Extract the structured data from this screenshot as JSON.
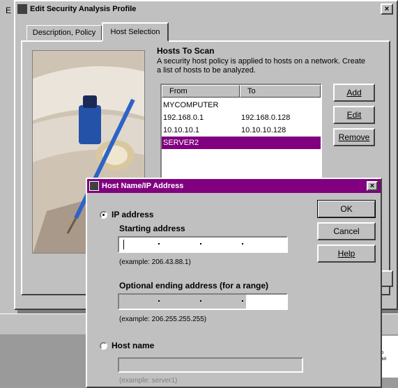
{
  "main_window": {
    "title": "Edit Security Analysis Profile",
    "close_glyph": "×",
    "left_strip_letter": "E",
    "tabs": [
      {
        "label": "Description, Policy",
        "active": false
      },
      {
        "label": "Host Selection",
        "active": true
      }
    ],
    "hosts_heading": "Hosts To Scan",
    "hosts_description": "A security host policy is applied to hosts on a network. Create a list of hosts to be analyzed.",
    "columns": [
      "From",
      "To"
    ],
    "hosts": [
      {
        "from": "MYCOMPUTER",
        "to": ""
      },
      {
        "from": "192.168.0.1",
        "to": "192.168.0.128"
      },
      {
        "from": "10.10.10.1",
        "to": "10.10.10.128"
      },
      {
        "from": "SERVER2",
        "to": "",
        "selected": true
      }
    ],
    "buttons": {
      "add": "Add",
      "edit": "Edit",
      "remove": "Remove"
    }
  },
  "dialog": {
    "title": "Host Name/IP Address",
    "close_glyph": "×",
    "ip_option_label": "IP address",
    "ip_option_selected": true,
    "starting_label": "Starting address",
    "starting_example": "(example: 206.43.88.1)",
    "ending_label": "Optional ending address (for a range)",
    "ending_example": "(example: 206.255.255.255)",
    "hostname_option_label": "Host name",
    "hostname_option_selected": false,
    "hostname_example": "(example: server1)",
    "buttons": {
      "ok": "OK",
      "cancel": "Cancel",
      "help": "Help"
    }
  },
  "background_snippet": [
    "Fo",
    "Pari"
  ],
  "colors": {
    "titlebar": "#800080",
    "selection": "#800080",
    "face": "#c0c0c0"
  }
}
